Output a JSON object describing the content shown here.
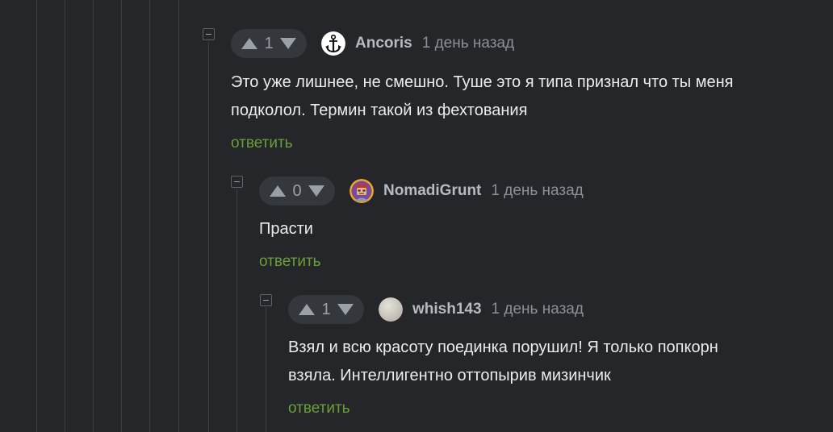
{
  "comments": [
    {
      "score": "1",
      "username": "Ancoris",
      "avatar_icon": "anchor-icon",
      "time": "1 день назад",
      "text_lines": [
        "Это уже лишнее, не смешно. Туше это я типа признал что ты меня",
        "подколол. Термин такой из фехтования"
      ],
      "reply_label": "ответить"
    },
    {
      "score": "0",
      "username": "NomadiGrunt",
      "avatar_icon": "robot-avatar-icon",
      "time": "1 день назад",
      "text_lines": [
        "Прасти"
      ],
      "reply_label": "ответить"
    },
    {
      "score": "1",
      "username": "whish143",
      "avatar_icon": "default-avatar-icon",
      "time": "1 день назад",
      "text_lines": [
        "Взял и всю красоту поединка порушил! Я только попкорн",
        "взяла. Интеллигентно оттопырив мизинчик"
      ],
      "reply_label": "ответить"
    }
  ],
  "colors": {
    "background": "#24262a",
    "reply_link": "#6a9e3a",
    "thread_line": "#3b3e44"
  }
}
